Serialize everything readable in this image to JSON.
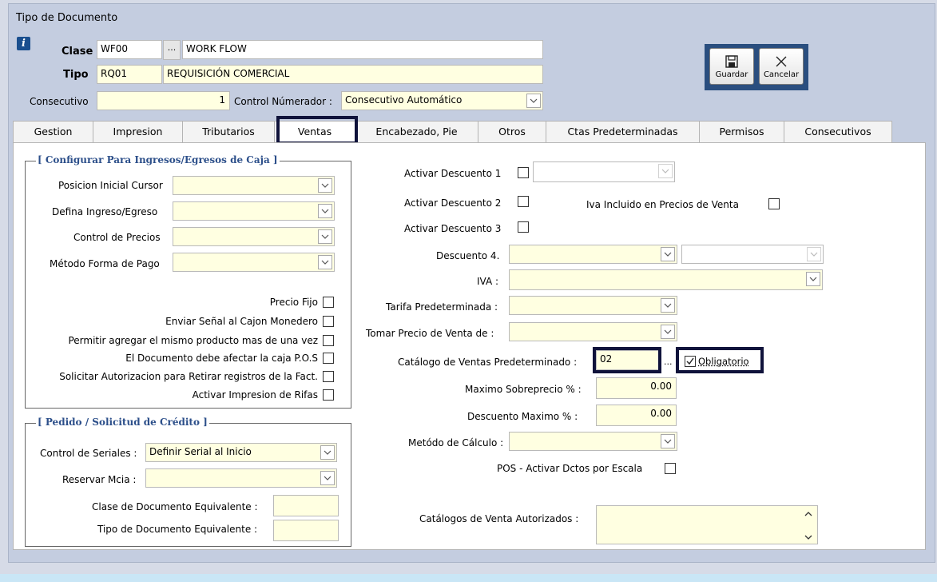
{
  "window": {
    "title": "Tipo de Documento"
  },
  "header": {
    "clase_label": "Clase",
    "clase_code": "WF00",
    "clase_lookup": "...",
    "clase_name": "WORK FLOW",
    "tipo_label": "Tipo",
    "tipo_code": "RQ01",
    "tipo_name": "REQUISICIÓN COMERCIAL",
    "consecutivo_label": "Consecutivo",
    "consecutivo_value": "1",
    "control_label": "Control Númerador :",
    "control_value": "Consecutivo Automático"
  },
  "toolbar": {
    "guardar_label": "Guardar",
    "cancelar_label": "Cancelar"
  },
  "tabs": [
    {
      "label": "Gestion"
    },
    {
      "label": "Impresion"
    },
    {
      "label": "Tributarios"
    },
    {
      "label": "Ventas"
    },
    {
      "label": "Encabezado, Pie"
    },
    {
      "label": "Otros"
    },
    {
      "label": "Ctas Predeterminadas"
    },
    {
      "label": "Permisos"
    },
    {
      "label": "Consecutivos"
    }
  ],
  "caja": {
    "title": "[ Configurar Para  Ingresos/Egresos de Caja ]",
    "posicion_label": "Posicion Inicial Cursor",
    "ingreso_label": "Defina Ingreso/Egreso",
    "precios_label": "Control de Precios",
    "forma_pago_label": "Método Forma de Pago",
    "checks": [
      "Precio Fijo",
      "Enviar Señal al Cajon Monedero",
      "Permitir agregar el mismo producto mas de una vez",
      "El Documento debe afectar la caja P.O.S",
      "Solicitar Autorizacion para Retirar registros de la Fact.",
      "Activar Impresion de Rifas"
    ]
  },
  "pedido": {
    "title": "[ Pedido / Solicitud de Crédito ]",
    "seriales_label": "Control de Seriales :",
    "seriales_value": "Definir Serial al Inicio",
    "reservar_label": "Reservar Mcia :",
    "clase_equiv_label": "Clase  de Documento Equivalente :",
    "tipo_equiv_label": "Tipo  de Documento Equivalente :"
  },
  "ventas": {
    "desc1_label": "Activar Descuento 1",
    "desc2_label": "Activar Descuento 2",
    "desc3_label": "Activar Descuento 3",
    "iva_incluido_label": "Iva Incluido en  Precios de Venta",
    "desc4_label": "Descuento 4.",
    "iva_label": "IVA :",
    "tarifa_label": "Tarifa Predeterminada :",
    "tomar_precio_label": "Tomar Precio de Venta de :",
    "catalogo_label": "Catálogo de Ventas Predeterminado :",
    "catalogo_value": "02",
    "catalogo_lookup": "...",
    "obligatorio_label": "Obligatorio",
    "sobreprecio_label": "Maximo Sobreprecio % :",
    "sobreprecio_value": "0.00",
    "desc_max_label": "Descuento Maximo  % :",
    "desc_max_value": "0.00",
    "metodo_label": "Metódo de Cálculo :",
    "pos_label": "POS - Activar Dctos por Escala",
    "catalogos_aut_label": "Catálogos de Venta Autorizados :"
  }
}
